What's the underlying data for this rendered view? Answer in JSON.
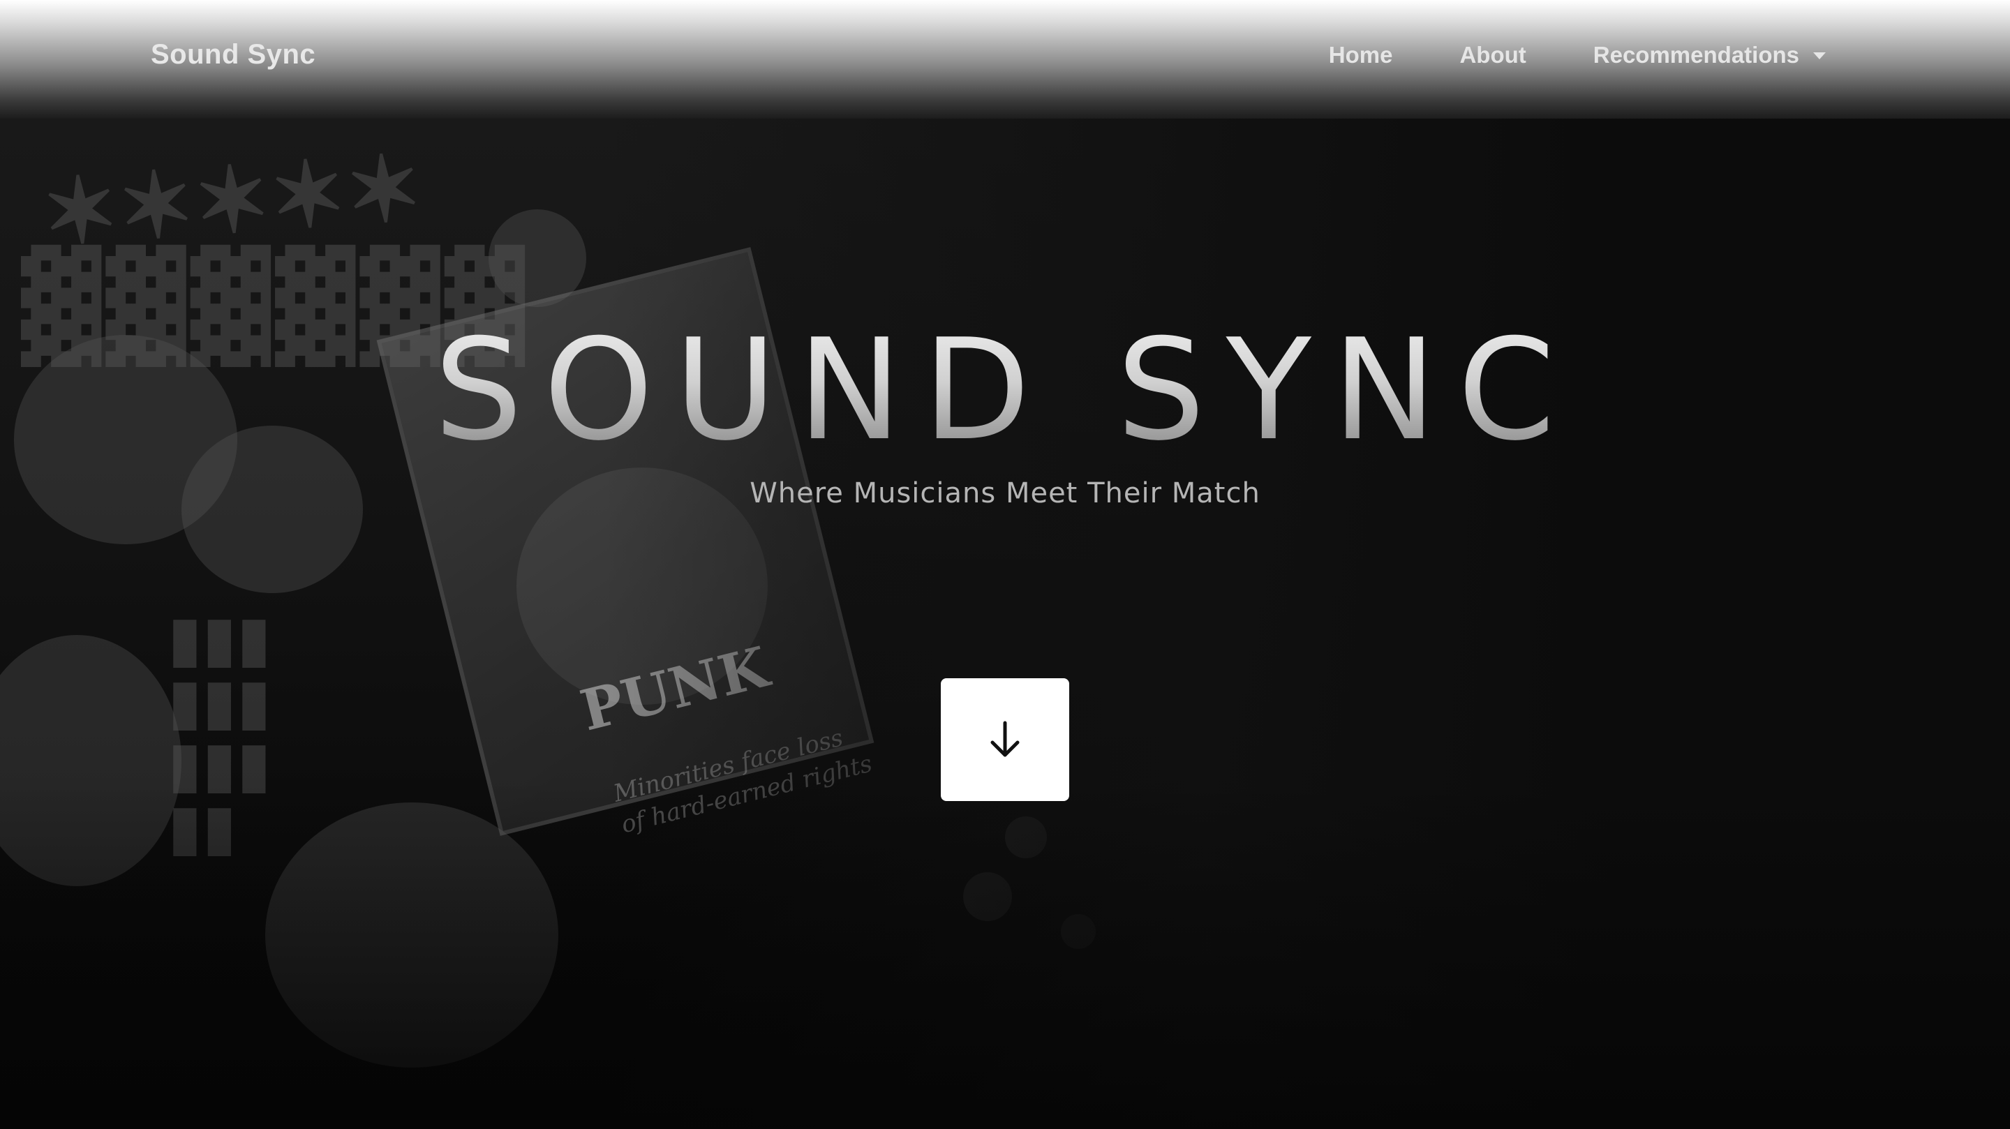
{
  "navbar": {
    "brand": "Sound Sync",
    "links": [
      {
        "label": "Home"
      },
      {
        "label": "About"
      },
      {
        "label": "Recommendations",
        "has_dropdown": true
      }
    ]
  },
  "hero": {
    "title": "SOUND SYNC",
    "subtitle": "Where Musicians Meet Their Match",
    "scroll_button_icon": "arrow-down-icon"
  },
  "background": {
    "album_title": "PUNK",
    "album_caption_line1": "Minorities face loss",
    "album_caption_line2": "of hard-earned rights"
  },
  "colors": {
    "page_background": "#0a0a0a",
    "scroll_button_bg": "#ffffff",
    "nav_text": "#e6e6e6",
    "subtitle_text": "#b5b5b5"
  }
}
